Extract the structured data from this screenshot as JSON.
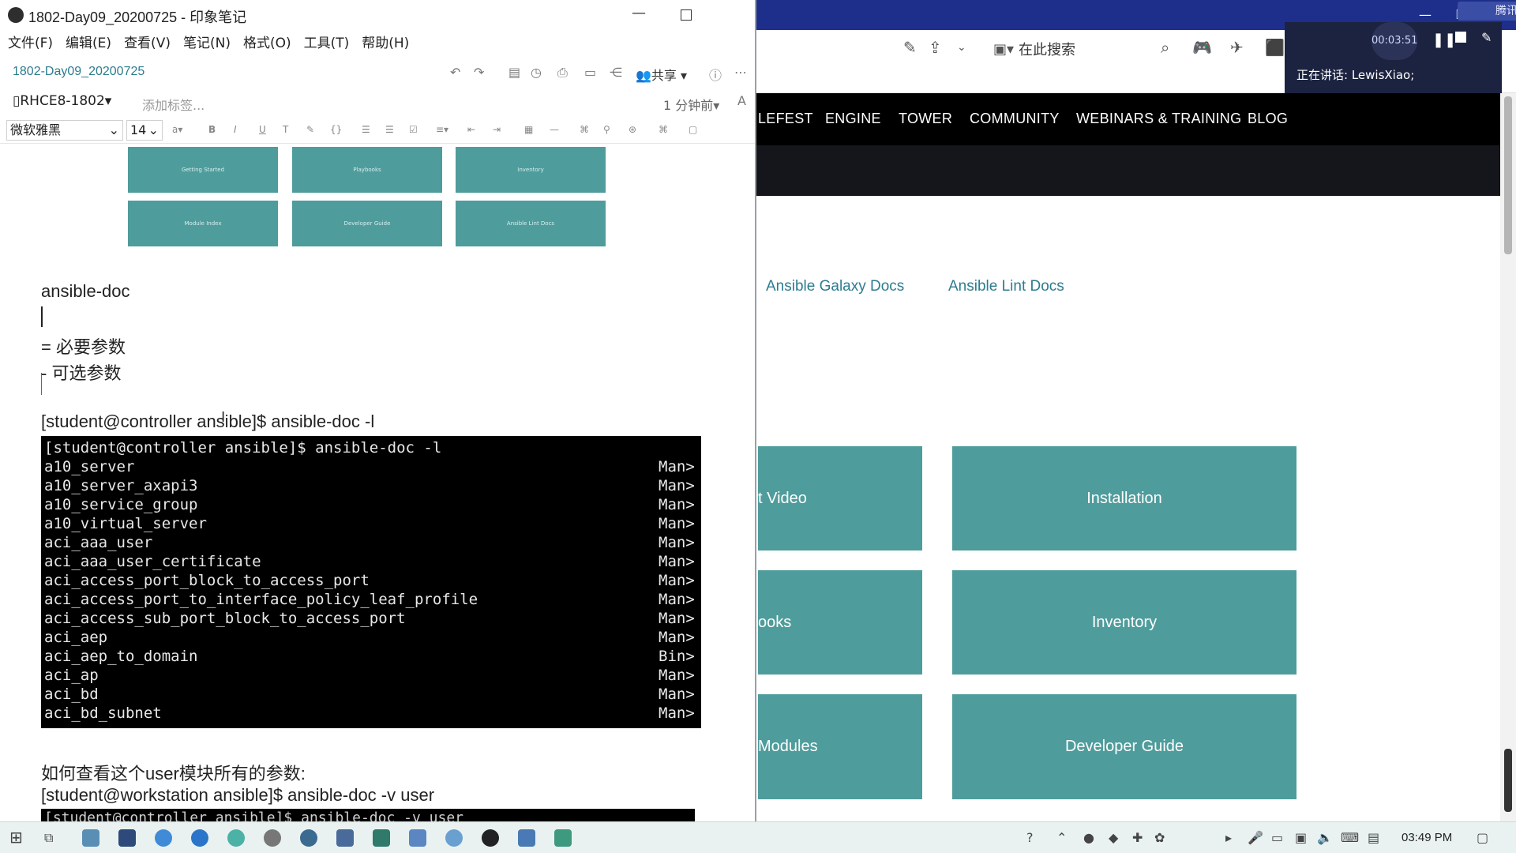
{
  "browser": {
    "meeting_label": "腾讯会议",
    "search_label": "在此搜索",
    "recording": {
      "time": "00:03:51",
      "speaking": "正在讲话: LewisXiao;"
    },
    "nav_items": [
      "LEFEST",
      "ENGINE",
      "TOWER",
      "COMMUNITY",
      "WEBINARS & TRAINING",
      "BLOG"
    ],
    "doc_links": [
      "Ansible Galaxy Docs",
      "Ansible Lint Docs"
    ],
    "tiles": [
      {
        "label": "t Video"
      },
      {
        "label": "Installation"
      },
      {
        "label": "ooks"
      },
      {
        "label": "Inventory"
      },
      {
        "label": "Modules"
      },
      {
        "label": "Developer Guide"
      }
    ],
    "accent_color": "#4f9c9c"
  },
  "evernote": {
    "window_title": "1802-Day09_20200725 - 印象笔记",
    "menu": [
      "文件(F)",
      "编辑(E)",
      "查看(V)",
      "笔记(N)",
      "格式(O)",
      "工具(T)",
      "帮助(H)"
    ],
    "note_title": "1802-Day09_20200725",
    "share_label": "共享",
    "notebook": "RHCE8-1802",
    "add_tag": "添加标签...",
    "updated": "1 分钟前",
    "font_name": "微软雅黑",
    "font_size": "14",
    "thumbnails": [
      "Getting Started",
      "Playbooks",
      "Inventory",
      "Module Index",
      "Developer Guide",
      "Ansible Lint Docs"
    ],
    "content": {
      "heading": "ansible-doc",
      "required": "= 必要参数",
      "optional": "- 可选参数",
      "command1": "[student@controller ansible]$ ansible-doc -l",
      "question": "如何查看这个user模块所有的参数:",
      "command2": "[student@workstation ansible]$ ansible-doc -v user"
    },
    "terminal": {
      "prompt": "[student@controller ansible]$ ansible-doc -l",
      "rows": [
        {
          "module": "a10_server",
          "desc": "Man>"
        },
        {
          "module": "a10_server_axapi3",
          "desc": "Man>"
        },
        {
          "module": "a10_service_group",
          "desc": "Man>"
        },
        {
          "module": "a10_virtual_server",
          "desc": "Man>"
        },
        {
          "module": "aci_aaa_user",
          "desc": "Man>"
        },
        {
          "module": "aci_aaa_user_certificate",
          "desc": "Man>"
        },
        {
          "module": "aci_access_port_block_to_access_port",
          "desc": "Man>"
        },
        {
          "module": "aci_access_port_to_interface_policy_leaf_profile",
          "desc": "Man>"
        },
        {
          "module": "aci_access_sub_port_block_to_access_port",
          "desc": "Man>"
        },
        {
          "module": "aci_aep",
          "desc": "Man>"
        },
        {
          "module": "aci_aep_to_domain",
          "desc": "Bin>"
        },
        {
          "module": "aci_ap",
          "desc": "Man>"
        },
        {
          "module": "aci_bd",
          "desc": "Man>"
        },
        {
          "module": "aci_bd_subnet",
          "desc": "Man>"
        }
      ],
      "partial_line": "[student@controller ansible]$ ansible-doc -v user"
    }
  },
  "taskbar": {
    "clock": "03:49 PM"
  }
}
